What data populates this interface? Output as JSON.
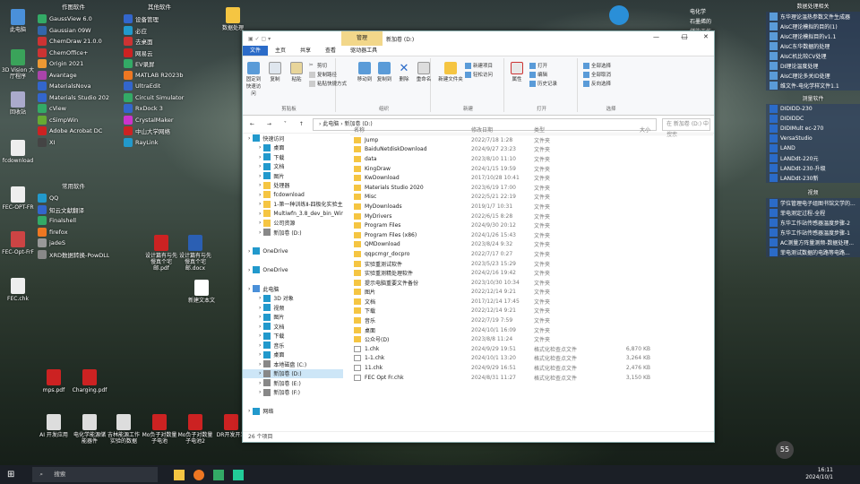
{
  "desktop_col1": [
    {
      "label": "此电脑",
      "c": "#4a90d9"
    },
    {
      "label": "3D Vision 大厅程序",
      "c": "#3aa35a"
    },
    {
      "label": "回收站",
      "c": "#aac"
    },
    {
      "label": "fcdownload",
      "c": "#eee"
    },
    {
      "label": "FEC-OPT-FR",
      "c": "#eee"
    },
    {
      "label": "FEC-Opt-FrF",
      "c": "#c44"
    },
    {
      "label": "FEC.chk",
      "c": "#eee"
    }
  ],
  "col2": {
    "header": "作图软件",
    "items": [
      {
        "label": "GaussView 6.0",
        "c": "#3a6"
      },
      {
        "label": "Gaussian 09W",
        "c": "#36a"
      },
      {
        "label": "ChemDraw 21.0.0",
        "c": "#c33"
      },
      {
        "label": "ChemOffice+",
        "c": "#c33"
      },
      {
        "label": "Origin 2021",
        "c": "#e93"
      },
      {
        "label": "Avantage",
        "c": "#a4a"
      },
      {
        "label": "MaterialsNova",
        "c": "#36c"
      },
      {
        "label": "Materials Studio 2020",
        "c": "#36c"
      },
      {
        "label": "cView",
        "c": "#3a6"
      },
      {
        "label": "cSimpWin",
        "c": "#6a3"
      },
      {
        "label": "Adobe Acrobat DC",
        "c": "#c22"
      },
      {
        "label": "XI",
        "c": "#444"
      }
    ]
  },
  "col3": {
    "header": "常用软件",
    "items": [
      {
        "label": "QQ",
        "c": "#29c"
      },
      {
        "label": "知云文献翻译",
        "c": "#36c"
      },
      {
        "label": "Finalshell",
        "c": "#3a6"
      },
      {
        "label": "firefox",
        "c": "#e72"
      },
      {
        "label": "jadeS",
        "c": "#999"
      },
      {
        "label": "XRD数据转换-PowDLL",
        "c": "#888"
      }
    ]
  },
  "col4": {
    "header": "其他软件",
    "items": [
      {
        "label": "设备管理",
        "c": "#36c"
      },
      {
        "label": "必应",
        "c": "#29c"
      },
      {
        "label": "去桌面",
        "c": "#c33"
      },
      {
        "label": "网易云",
        "c": "#c22"
      },
      {
        "label": "EV录屏",
        "c": "#3a6"
      },
      {
        "label": "MATLAB R2023b",
        "c": "#e72"
      },
      {
        "label": "UltraEdit",
        "c": "#36c"
      },
      {
        "label": "Circuit Simulator",
        "c": "#3a6"
      },
      {
        "label": "RxDock 3",
        "c": "#36c"
      },
      {
        "label": "CrystalMaker",
        "c": "#c3c"
      },
      {
        "label": "中山大学网络",
        "c": "#c22"
      },
      {
        "label": "RayLink",
        "c": "#29c"
      }
    ]
  },
  "mid_icons": [
    {
      "label": "设计篇有与先慢真个宅邮.pdf",
      "c": "#c22"
    },
    {
      "label": "设计篇有与先慢真个宅邮.docx",
      "c": "#2b5fb3"
    },
    {
      "label": "新建文本文",
      "c": "#fff"
    }
  ],
  "bottom_icons": [
    {
      "label": "mps.pdf",
      "c": "#c22"
    },
    {
      "label": "Charging.pdf",
      "c": "#c22"
    },
    {
      "label": "AI 开发应用",
      "c": "#ddd"
    },
    {
      "label": "电化学能源储能器件",
      "c": "#ddd"
    },
    {
      "label": "吉林能源工作实验的数据",
      "c": "#ddd"
    },
    {
      "label": "Mo负子对数量子电池",
      "c": "#c22"
    },
    {
      "label": "Mo负子对数量子电池2",
      "c": "#c22"
    },
    {
      "label": "DR开发开发",
      "c": "#c22"
    }
  ],
  "top_folder": "数据处理",
  "right_panel": {
    "header1": "数据处理相关",
    "items1": [
      "东华理论温热参数文件生成器",
      "AIsC理论模拟的目的(1)",
      "AIsC理论模拟目的v1.1",
      "AIsC东华数据的处理",
      "AIsC机比较CV处理",
      "DI理论温度处理",
      "AIsC理论多关ID处理",
      "维文件-电化学样文件1.1"
    ],
    "header2": "测量软件",
    "items2": [
      "DIDIDD-230",
      "DIDIDDC",
      "DIDIMult ec-270",
      "VersaStudio",
      "LAND",
      "LANDdt-220元",
      "LANDdt-230-升级",
      "LANDdt-230新"
    ],
    "header3": "视频",
    "items3": [
      "学位管理电子组图书馆文学的...",
      "菲电测定过程-全程",
      "东华工作站传感器温度步骤-2",
      "东华工作站传感器温度步骤-1",
      "AC测量方阵量测频-数据处理...",
      "菲电测试数据的电路等电路..."
    ]
  },
  "top_mid_folders": [
    "电化学",
    "石墨烯的",
    "储能工作"
  ],
  "window": {
    "title": "新加卷 (D:)",
    "manage_tab": "管理",
    "tool_tab": "驱动器工具",
    "controls": {
      "min": "—",
      "max": "□",
      "close": "✕"
    },
    "tabs": [
      "文件",
      "主页",
      "共享",
      "查看",
      "驱动器工具"
    ],
    "ribbon": {
      "clipboard": "剪贴板",
      "organize": "组织",
      "new": "新建",
      "open": "打开",
      "select": "选择",
      "pin": "固定到快速访问",
      "copy": "复制",
      "paste": "粘贴",
      "cut": "剪切",
      "copy_path": "复制路径",
      "paste_shortcut": "粘贴快捷方式",
      "move_to": "移动到",
      "copy_to": "复制到",
      "delete": "删除",
      "rename": "重命名",
      "new_folder": "新建文件夹",
      "new_item": "新建项目",
      "easy_access": "轻松访问",
      "properties": "属性",
      "open_btn": "打开",
      "edit": "编辑",
      "history": "历史记录",
      "select_all": "全部选择",
      "select_none": "全部取消",
      "invert": "反向选择"
    },
    "address": "› 此电脑 › 新加卷 (D:)",
    "search": "在 新加卷 (D:) 中搜索",
    "nav": [
      {
        "label": "快速访问",
        "ind": 0,
        "c": "#29c"
      },
      {
        "label": "桌面",
        "ind": 1,
        "c": "#29c"
      },
      {
        "label": "下载",
        "ind": 1,
        "c": "#29c"
      },
      {
        "label": "文档",
        "ind": 1,
        "c": "#29c"
      },
      {
        "label": "图片",
        "ind": 1,
        "c": "#29c"
      },
      {
        "label": "处理器",
        "ind": 1,
        "c": "#f5c542"
      },
      {
        "label": "fcdownload",
        "ind": 1,
        "c": "#f5c542"
      },
      {
        "label": "1-第一种训练Ⅱ-四极化实验主成",
        "ind": 1,
        "c": "#f5c542"
      },
      {
        "label": "Multiwfn_3.8_dev_bin_Win64",
        "ind": 1,
        "c": "#f5c542"
      },
      {
        "label": "公司资源",
        "ind": 1,
        "c": "#f5c542"
      },
      {
        "label": "新加卷 (D:)",
        "ind": 1,
        "c": "#888"
      },
      {
        "label": "",
        "ind": 0,
        "c": "transparent"
      },
      {
        "label": "OneDrive",
        "ind": 0,
        "c": "#29c"
      },
      {
        "label": "",
        "ind": 0,
        "c": "transparent"
      },
      {
        "label": "OneDrive",
        "ind": 0,
        "c": "#29c"
      },
      {
        "label": "",
        "ind": 0,
        "c": "transparent"
      },
      {
        "label": "此电脑",
        "ind": 0,
        "c": "#4a90d9"
      },
      {
        "label": "3D 对象",
        "ind": 1,
        "c": "#29c"
      },
      {
        "label": "视频",
        "ind": 1,
        "c": "#29c"
      },
      {
        "label": "图片",
        "ind": 1,
        "c": "#29c"
      },
      {
        "label": "文档",
        "ind": 1,
        "c": "#29c"
      },
      {
        "label": "下载",
        "ind": 1,
        "c": "#29c"
      },
      {
        "label": "音乐",
        "ind": 1,
        "c": "#29c"
      },
      {
        "label": "桌面",
        "ind": 1,
        "c": "#29c"
      },
      {
        "label": "本地磁盘 (C:)",
        "ind": 1,
        "c": "#888"
      },
      {
        "label": "新加卷 (D:)",
        "ind": 1,
        "c": "#888",
        "sel": true
      },
      {
        "label": "新加卷 (E:)",
        "ind": 1,
        "c": "#888"
      },
      {
        "label": "新加卷 (F:)",
        "ind": 1,
        "c": "#888"
      },
      {
        "label": "",
        "ind": 0,
        "c": "transparent"
      },
      {
        "label": "网络",
        "ind": 0,
        "c": "#29c"
      }
    ],
    "headers": [
      "名称",
      "修改日期",
      "类型",
      "大小"
    ],
    "files": [
      {
        "n": "Jump",
        "d": "2022/7/18 1:28",
        "t": "文件夹",
        "s": "",
        "f": 1
      },
      {
        "n": "BaiduNetdiskDownload",
        "d": "2024/9/27 23:23",
        "t": "文件夹",
        "s": "",
        "f": 1
      },
      {
        "n": "data",
        "d": "2023/8/10 11:10",
        "t": "文件夹",
        "s": "",
        "f": 1
      },
      {
        "n": "KingDraw",
        "d": "2024/1/15 19:59",
        "t": "文件夹",
        "s": "",
        "f": 1
      },
      {
        "n": "KwDownload",
        "d": "2017/10/28 10:41",
        "t": "文件夹",
        "s": "",
        "f": 1
      },
      {
        "n": "Materials Studio 2020",
        "d": "2023/6/19 17:00",
        "t": "文件夹",
        "s": "",
        "f": 1
      },
      {
        "n": "Misc",
        "d": "2022/5/21 22:19",
        "t": "文件夹",
        "s": "",
        "f": 1
      },
      {
        "n": "MyDownloads",
        "d": "2019/1/7 10:31",
        "t": "文件夹",
        "s": "",
        "f": 1
      },
      {
        "n": "MyDrivers",
        "d": "2022/6/15 8:28",
        "t": "文件夹",
        "s": "",
        "f": 1
      },
      {
        "n": "Program Files",
        "d": "2024/9/30 20:12",
        "t": "文件夹",
        "s": "",
        "f": 1
      },
      {
        "n": "Program Files (x86)",
        "d": "2024/1/26 15:43",
        "t": "文件夹",
        "s": "",
        "f": 1
      },
      {
        "n": "QMDownload",
        "d": "2023/8/24 9:32",
        "t": "文件夹",
        "s": "",
        "f": 1
      },
      {
        "n": "qqpcmgr_docpro",
        "d": "2022/7/17 0:27",
        "t": "文件夹",
        "s": "",
        "f": 1
      },
      {
        "n": "实验重测试软件",
        "d": "2023/5/23 15:29",
        "t": "文件夹",
        "s": "",
        "f": 1
      },
      {
        "n": "实验重测精处理软件",
        "d": "2024/2/16 19:42",
        "t": "文件夹",
        "s": "",
        "f": 1
      },
      {
        "n": "提示电脑重要文件备份",
        "d": "2023/10/30 10:34",
        "t": "文件夹",
        "s": "",
        "f": 1
      },
      {
        "n": "图片",
        "d": "2022/12/14 9:21",
        "t": "文件夹",
        "s": "",
        "f": 1
      },
      {
        "n": "文档",
        "d": "2017/12/14 17:45",
        "t": "文件夹",
        "s": "",
        "f": 1
      },
      {
        "n": "下载",
        "d": "2022/12/14 9:21",
        "t": "文件夹",
        "s": "",
        "f": 1
      },
      {
        "n": "音乐",
        "d": "2022/7/19 7:59",
        "t": "文件夹",
        "s": "",
        "f": 1
      },
      {
        "n": "桌面",
        "d": "2024/10/1 16:09",
        "t": "文件夹",
        "s": "",
        "f": 1
      },
      {
        "n": "公众号(D)",
        "d": "2023/8/8 11:24",
        "t": "文件夹",
        "s": "",
        "f": 1
      },
      {
        "n": "1.chk",
        "d": "2024/9/29 19:51",
        "t": "格式化检查点文件",
        "s": "6,870 KB",
        "f": 0
      },
      {
        "n": "1-1.chk",
        "d": "2024/10/1 13:20",
        "t": "格式化检查点文件",
        "s": "3,264 KB",
        "f": 0
      },
      {
        "n": "11.chk",
        "d": "2024/9/29 16:51",
        "t": "格式化检查点文件",
        "s": "2,476 KB",
        "f": 0
      },
      {
        "n": "FEC Opt Fr.chk",
        "d": "2024/8/31 11:27",
        "t": "格式化检查点文件",
        "s": "3,150 KB",
        "f": 0
      }
    ],
    "status": "26 个项目"
  },
  "taskbar": {
    "search": "搜索",
    "time": "16:11",
    "date": "2024/10/1"
  },
  "overlay_num": "55"
}
